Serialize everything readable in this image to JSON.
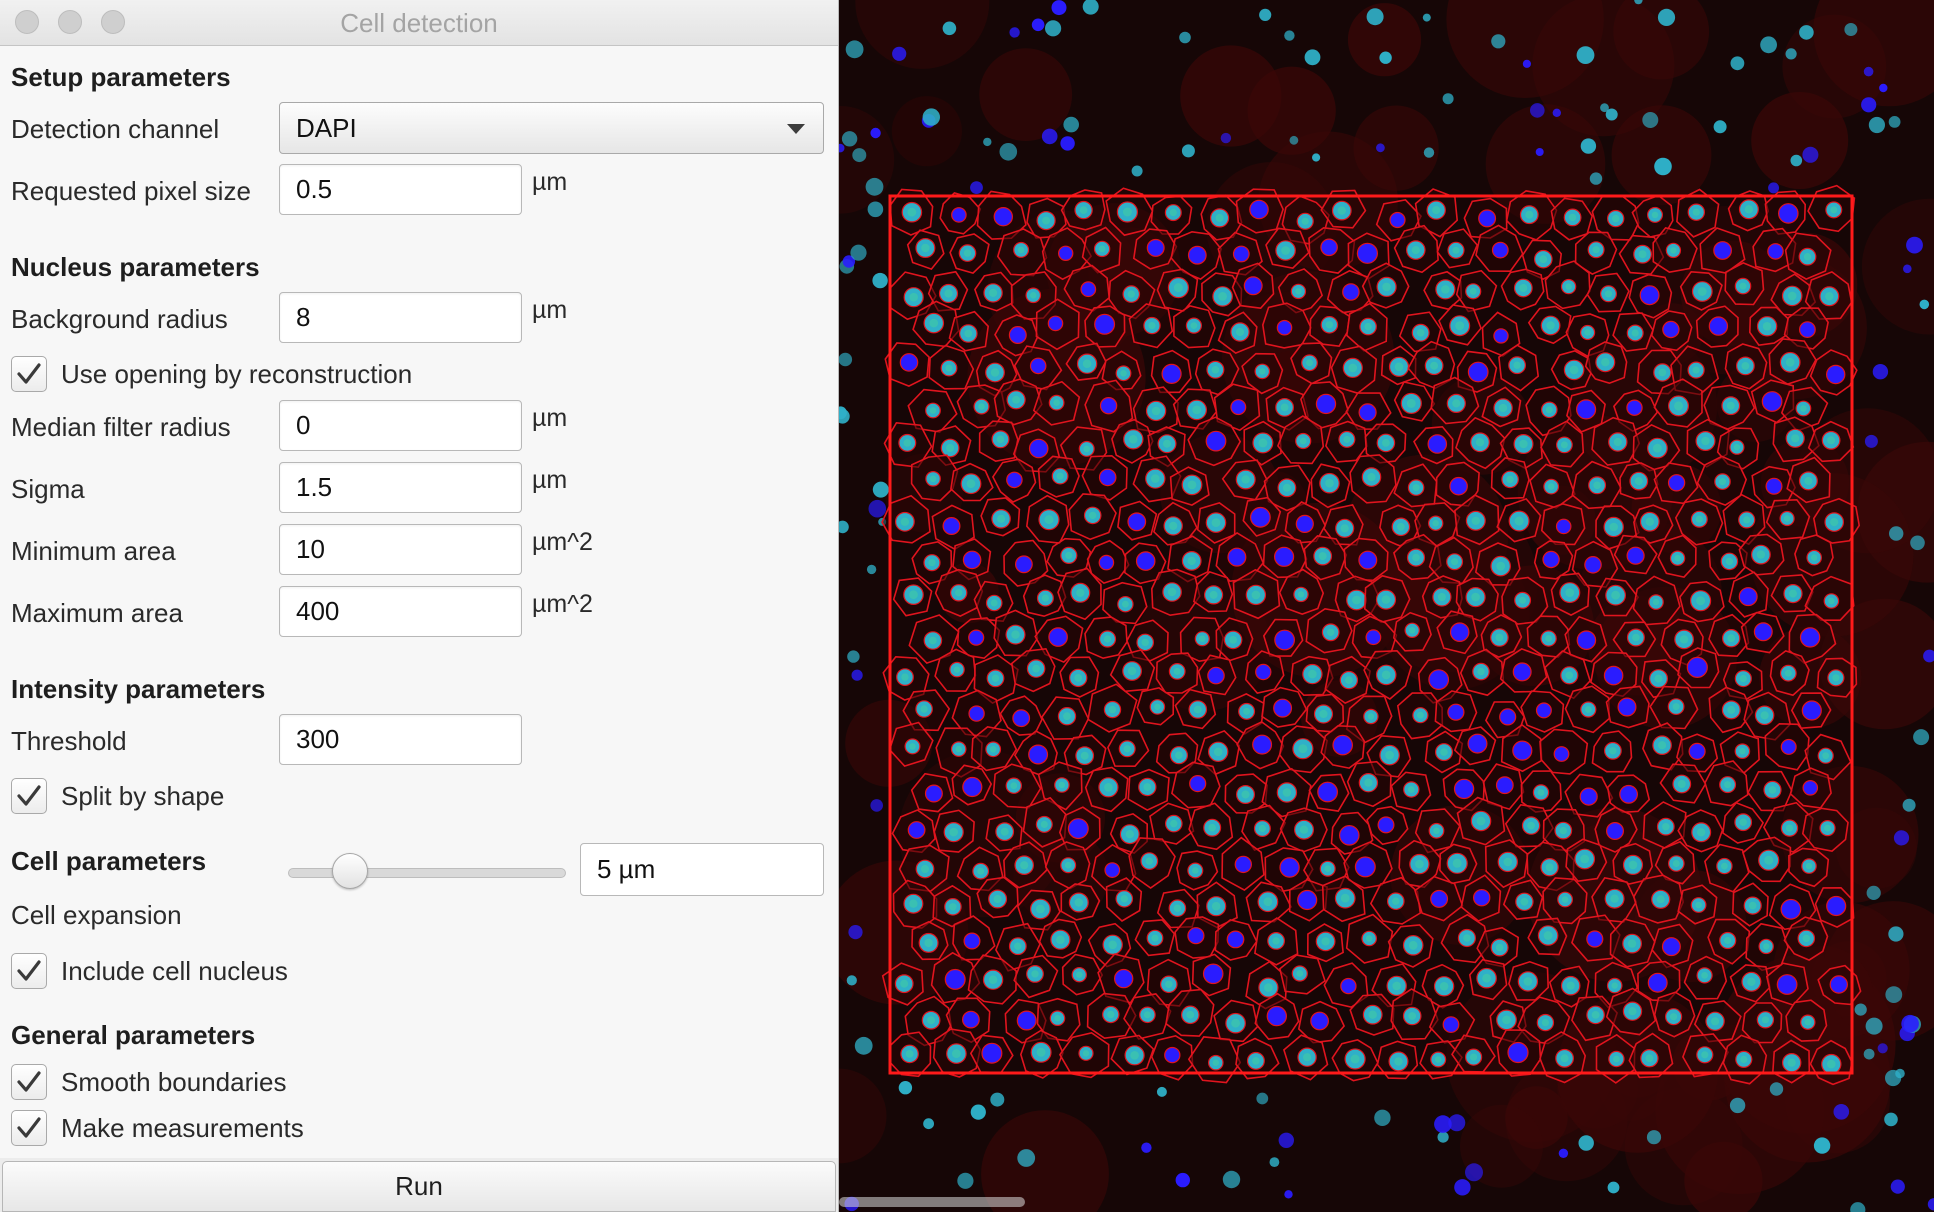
{
  "window": {
    "title": "Cell detection"
  },
  "setup": {
    "heading": "Setup parameters",
    "detection_channel": {
      "label": "Detection channel",
      "value": "DAPI"
    },
    "pixel_size": {
      "label": "Requested pixel size",
      "value": "0.5",
      "unit": "µm"
    }
  },
  "nucleus": {
    "heading": "Nucleus parameters",
    "background_radius": {
      "label": "Background radius",
      "value": "8",
      "unit": "µm"
    },
    "opening_by_reconstruction": {
      "label": "Use opening by reconstruction",
      "checked": true
    },
    "median_filter_radius": {
      "label": "Median filter radius",
      "value": "0",
      "unit": "µm"
    },
    "sigma": {
      "label": "Sigma",
      "value": "1.5",
      "unit": "µm"
    },
    "minimum_area": {
      "label": "Minimum area",
      "value": "10",
      "unit": "µm^2"
    },
    "maximum_area": {
      "label": "Maximum area",
      "value": "400",
      "unit": "µm^2"
    }
  },
  "intensity": {
    "heading": "Intensity parameters",
    "threshold": {
      "label": "Threshold",
      "value": "300"
    },
    "split_by_shape": {
      "label": "Split by shape",
      "checked": true
    }
  },
  "cell": {
    "heading": "Cell parameters",
    "cell_expansion": {
      "label": "Cell expansion",
      "value": "5 µm",
      "slider_fraction": 0.18
    },
    "include_nucleus": {
      "label": "Include cell nucleus",
      "checked": true
    }
  },
  "general": {
    "heading": "General parameters",
    "smooth_boundaries": {
      "label": "Smooth boundaries",
      "checked": true
    },
    "make_measurements": {
      "label": "Make measurements",
      "checked": true
    }
  },
  "run_button": {
    "label": "Run"
  },
  "colors": {
    "roi": "#ff1a1a",
    "cell_outline": "#e0141e",
    "nucleus_cyan": "#2fb0c8",
    "nucleus_blue": "#2a1cff",
    "tissue": "#3a0707"
  }
}
